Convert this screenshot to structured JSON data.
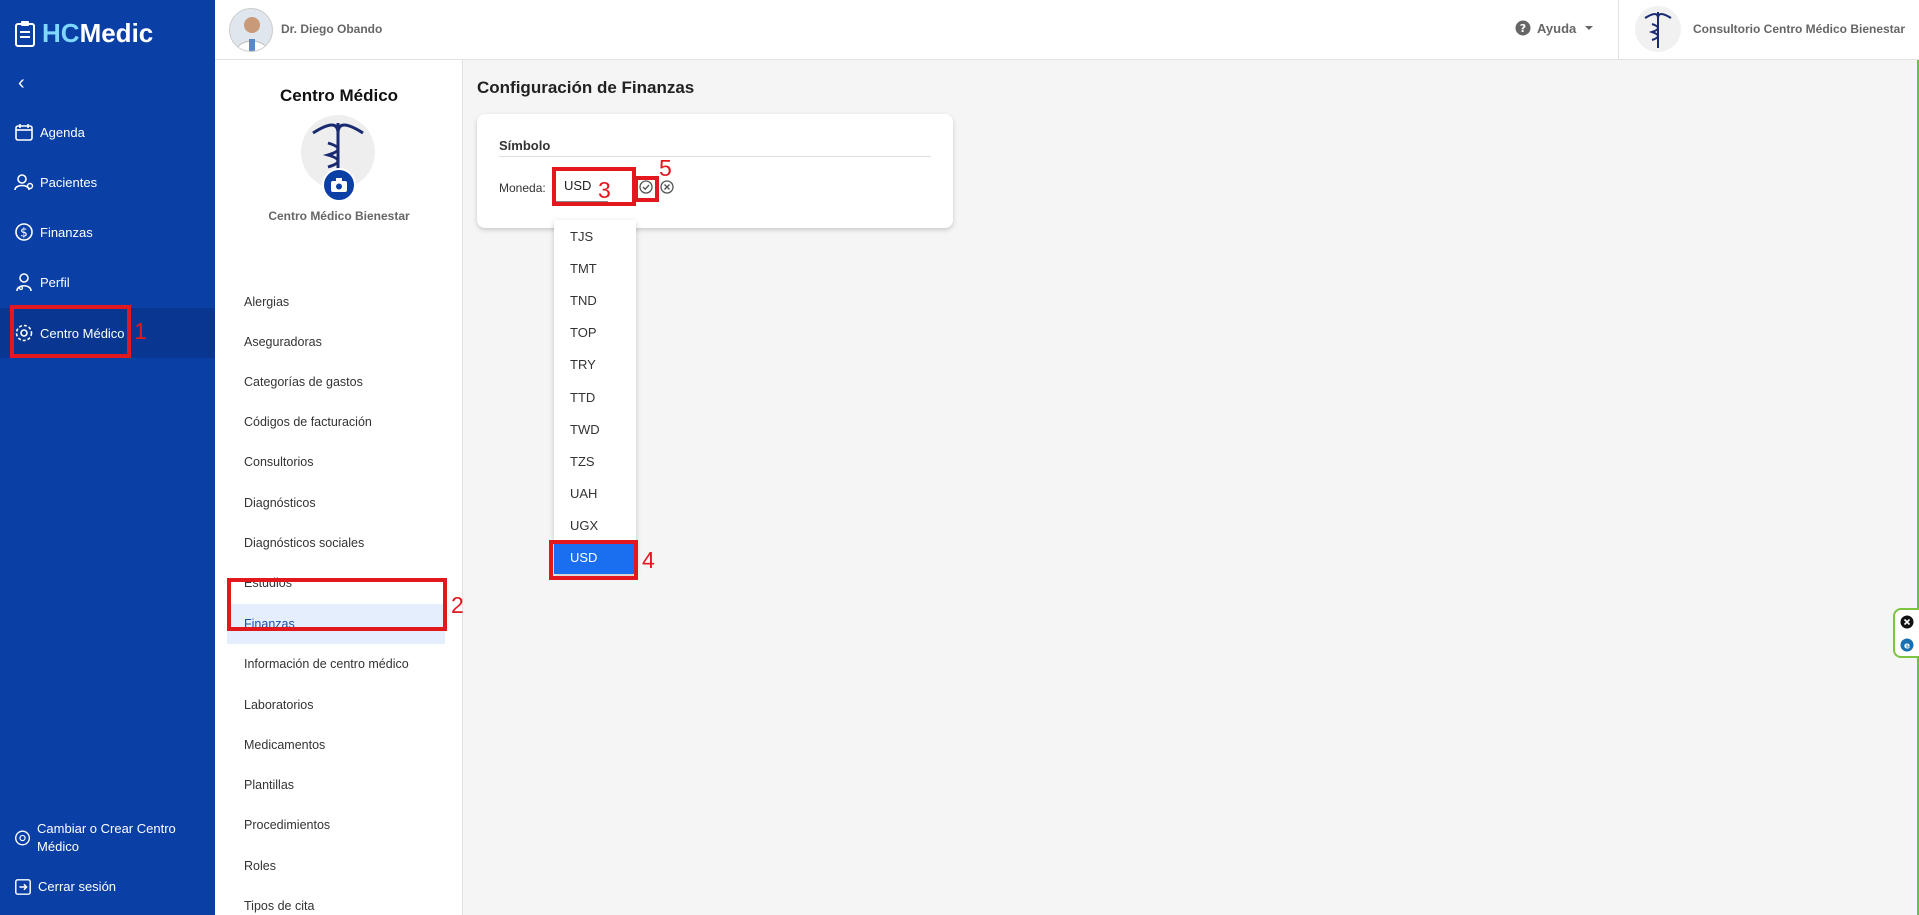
{
  "app": {
    "logo_hc": "HC",
    "logo_medic": "Medic"
  },
  "sidebar": {
    "collapse_glyph": "‹",
    "items": [
      {
        "label": "Agenda",
        "icon": "calendar-icon"
      },
      {
        "label": "Pacientes",
        "icon": "patients-icon"
      },
      {
        "label": "Finanzas",
        "icon": "dollar-icon"
      },
      {
        "label": "Perfil",
        "icon": "doctor-icon"
      },
      {
        "label": "Centro Médico",
        "icon": "gear-icon",
        "active": true
      }
    ],
    "bottom": {
      "switch_label": "Cambiar o Crear Centro Médico",
      "logout_label": "Cerrar sesión"
    }
  },
  "topbar": {
    "doctor_name": "Dr. Diego Obando",
    "help_label": "Ayuda",
    "clinic_name": "Consultorio Centro Médico Bienestar"
  },
  "panel": {
    "title": "Centro Médico",
    "clinic_name": "Centro Médico Bienestar",
    "menu": [
      "Alergias",
      "Aseguradoras",
      "Categorías de gastos",
      "Códigos de facturación",
      "Consultorios",
      "Diagnósticos",
      "Diagnósticos sociales",
      "Estudios",
      "Finanzas",
      "Información de centro médico",
      "Laboratorios",
      "Medicamentos",
      "Plantillas",
      "Procedimientos",
      "Roles",
      "Tipos de cita"
    ],
    "active_item": "Finanzas"
  },
  "main": {
    "title": "Configuración de Finanzas",
    "section_label": "Símbolo",
    "currency_label": "Moneda:",
    "currency_value": "USD",
    "dropdown_options": [
      "TJS",
      "TMT",
      "TND",
      "TOP",
      "TRY",
      "TTD",
      "TWD",
      "TZS",
      "UAH",
      "UGX",
      "USD"
    ],
    "selected_option": "USD"
  },
  "annotations": [
    "1",
    "2",
    "3",
    "4",
    "5"
  ],
  "colors": {
    "sidebar": "#0a3fa5",
    "sidebar_active": "#083691",
    "accent": "#1a6ff0",
    "annotation_red": "#e3181f",
    "active_menu_bg": "#e4eefd"
  }
}
